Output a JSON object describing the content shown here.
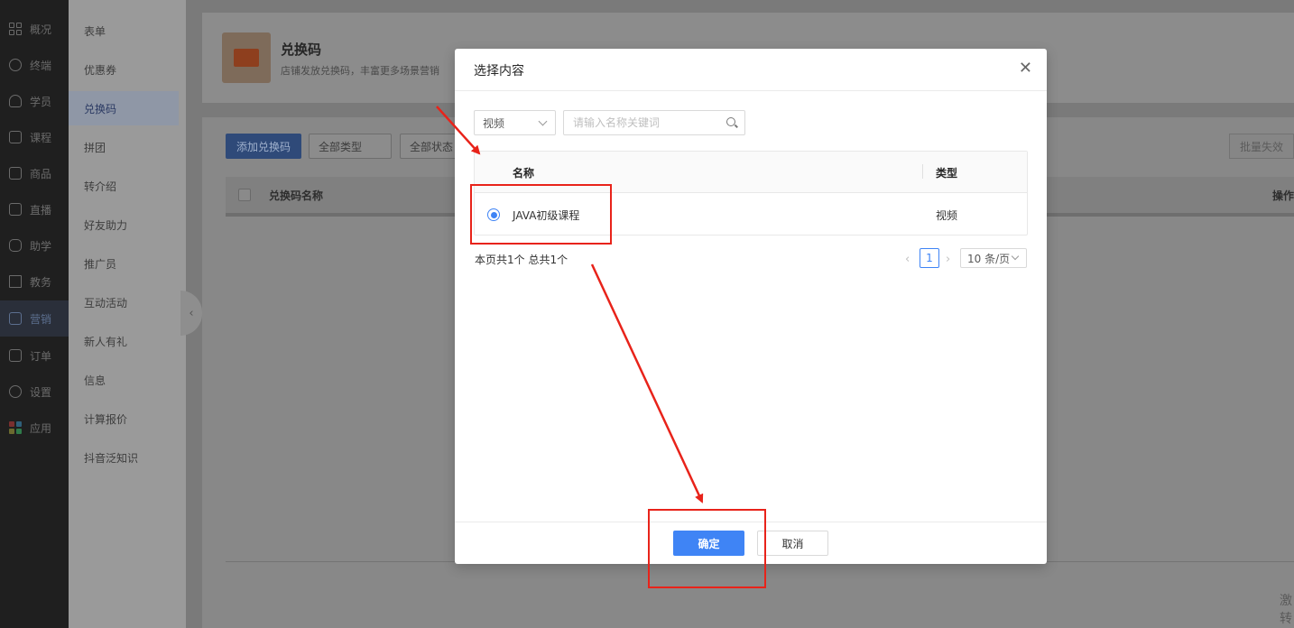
{
  "nav": {
    "items": [
      {
        "label": "概况",
        "icon": "grid-icon"
      },
      {
        "label": "终端",
        "icon": "terminal-icon"
      },
      {
        "label": "学员",
        "icon": "users-icon"
      },
      {
        "label": "课程",
        "icon": "course-icon"
      },
      {
        "label": "商品",
        "icon": "goods-icon"
      },
      {
        "label": "直播",
        "icon": "live-icon"
      },
      {
        "label": "助学",
        "icon": "gamepad-icon"
      },
      {
        "label": "教务",
        "icon": "book-icon"
      },
      {
        "label": "营销",
        "icon": "marketing-icon",
        "active": true
      },
      {
        "label": "订单",
        "icon": "order-icon"
      },
      {
        "label": "设置",
        "icon": "settings-icon"
      },
      {
        "label": "应用",
        "icon": "apps-icon"
      }
    ]
  },
  "subnav": {
    "items": [
      "表单",
      "优惠券",
      "兑换码",
      "拼团",
      "转介绍",
      "好友助力",
      "推广员",
      "互动活动",
      "新人有礼",
      "信息",
      "计算报价",
      "抖音泛知识"
    ],
    "active_index": 2
  },
  "page": {
    "title": "兑换码",
    "subtitle": "店铺发放兑换码，丰富更多场景营销",
    "add_button": "添加兑换码",
    "filter_type": "全部类型",
    "filter_status": "全部状态",
    "batch_button": "批量失效",
    "col_name": "兑换码名称",
    "col_action": "操作",
    "corner_text": "激活\n转"
  },
  "modal": {
    "title": "选择内容",
    "close_symbol": "✕",
    "type_select": "视频",
    "search_placeholder": "请输入名称关键词",
    "columns": {
      "name": "名称",
      "type": "类型"
    },
    "rows": [
      {
        "name": "JAVA初级课程",
        "type": "视频",
        "selected": true
      }
    ],
    "page_info": "本页共1个 总共1个",
    "pager": {
      "prev": "‹",
      "current": "1",
      "next": "›",
      "page_size": "10 条/页"
    },
    "ok_button": "确定",
    "cancel_button": "取消"
  },
  "colors": {
    "primary": "#3f84f5",
    "annotation": "#e8231a"
  }
}
